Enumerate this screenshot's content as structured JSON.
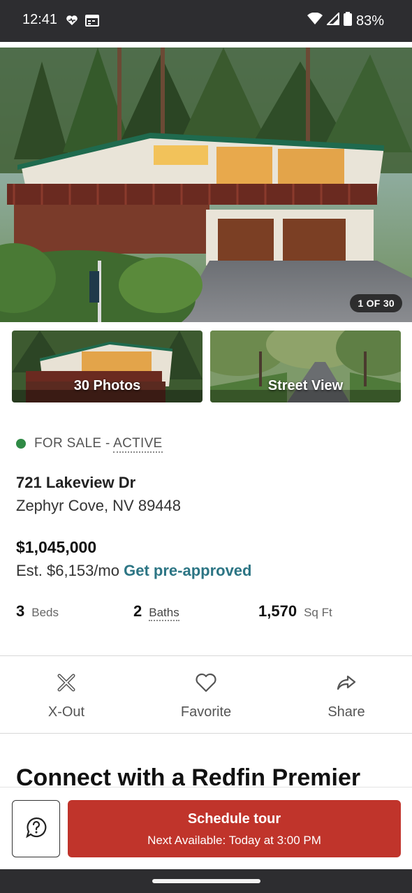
{
  "status_bar": {
    "time": "12:41",
    "battery": "83%",
    "icons": [
      "heart-pulse-icon",
      "calendar-icon",
      "wifi-icon",
      "signal-icon",
      "battery-icon"
    ]
  },
  "hero": {
    "photo_counter": "1 OF 30"
  },
  "thumbnails": {
    "photos_label": "30 Photos",
    "street_view_label": "Street View"
  },
  "listing": {
    "status_prefix": "FOR SALE - ",
    "status_active": "ACTIVE",
    "status_color": "#2f8a45",
    "street": "721 Lakeview Dr",
    "city_line": "Zephyr Cove, NV 89448",
    "price": "$1,045,000",
    "est_payment": "Est. $6,153/mo",
    "preapproved_link": "Get pre-approved"
  },
  "stats": {
    "beds_value": "3",
    "beds_label": "Beds",
    "baths_value": "2",
    "baths_label": "Baths",
    "sqft_value": "1,570",
    "sqft_label": "Sq Ft"
  },
  "actions": {
    "xout_label": "X-Out",
    "favorite_label": "Favorite",
    "share_label": "Share"
  },
  "connect": {
    "heading": "Connect with a Redfin Premier"
  },
  "bottom_bar": {
    "schedule_title": "Schedule tour",
    "schedule_subtitle": "Next Available: Today at 3:00 PM",
    "accent_color": "#c0342b"
  }
}
